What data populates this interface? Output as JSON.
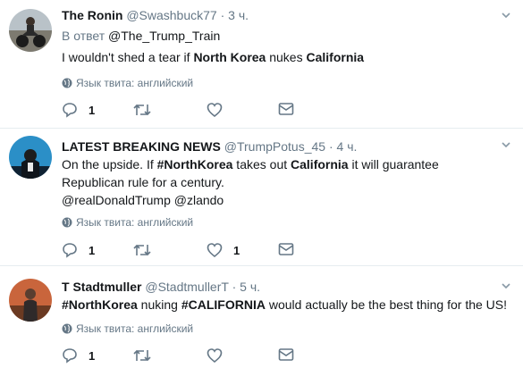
{
  "tweets": [
    {
      "name": "The Ronin",
      "handle": "@Swashbuck77",
      "separator": "·",
      "time": "3 ч.",
      "reply_prefix": "В ответ",
      "reply_to": "@The_Trump_Train",
      "text_parts": [
        "I wouldn't shed a tear if ",
        "North Korea",
        " nukes ",
        "California"
      ],
      "language_label": "Язык твита: английский",
      "reply_count": "1",
      "retweet_count": "",
      "like_count": ""
    },
    {
      "name": "LATEST BREAKING NEWS",
      "handle": "@TrumpPotus_45",
      "separator": "·",
      "time": "4 ч.",
      "text_line1_parts": [
        "On the upside. If ",
        "#NorthKorea",
        " takes out ",
        "California",
        " it will guarantee"
      ],
      "text_line2": "Republican rule for a century.",
      "text_line3": "@realDonaldTrump @zlando",
      "language_label": "Язык твита: английский",
      "reply_count": "1",
      "retweet_count": "",
      "like_count": "1"
    },
    {
      "name": "T Stadtmuller",
      "handle": "@StadtmullerT",
      "separator": "·",
      "time": "5 ч.",
      "text_parts": [
        "#NorthKorea",
        " nuking ",
        "#CALIFORNIA",
        " would actually be the best thing for the US!"
      ],
      "language_label": "Язык твита: английский",
      "reply_count": "1",
      "retweet_count": "",
      "like_count": ""
    }
  ],
  "icons": {
    "reply": "reply-icon",
    "retweet": "retweet-icon",
    "like": "heart-icon",
    "dm": "envelope-icon",
    "globe": "globe-icon",
    "caret": "chevron-down-icon"
  },
  "colors": {
    "name": "#14171a",
    "muted": "#657786",
    "divider": "#e6ecf0"
  }
}
